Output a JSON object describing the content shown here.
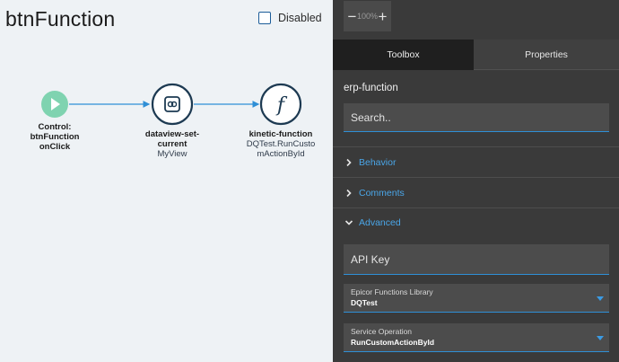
{
  "canvas": {
    "title": "btnFunction",
    "disabled_label": "Disabled",
    "nodes": [
      {
        "title": "Control:",
        "title2": "btnFunction",
        "subtitle": "onClick",
        "icon": "play-icon"
      },
      {
        "title": "dataview-set-",
        "title2": "current",
        "subtitle": "MyView",
        "icon": "link-icon"
      },
      {
        "title": "kinetic-function",
        "subtitle": "DQTest.RunCusto",
        "subtitle2": "mActionById",
        "icon": "function-icon"
      }
    ]
  },
  "panel": {
    "zoom": {
      "minus": "−",
      "value": "100%",
      "plus": "+"
    },
    "tabs": {
      "toolbox": "Toolbox",
      "properties": "Properties"
    },
    "function_name": "erp-function",
    "search_placeholder": "Search..",
    "sections": {
      "behavior": "Behavior",
      "comments": "Comments",
      "advanced": "Advanced"
    },
    "api_key_placeholder": "API Key",
    "library": {
      "label": "Epicor Functions Library",
      "value": "DQTest"
    },
    "operation": {
      "label": "Service Operation",
      "value": "RunCustomActionById"
    }
  },
  "colors": {
    "accent": "#2f8fd6",
    "start_node": "#7fd3b0",
    "node_border": "#1d3a52"
  }
}
